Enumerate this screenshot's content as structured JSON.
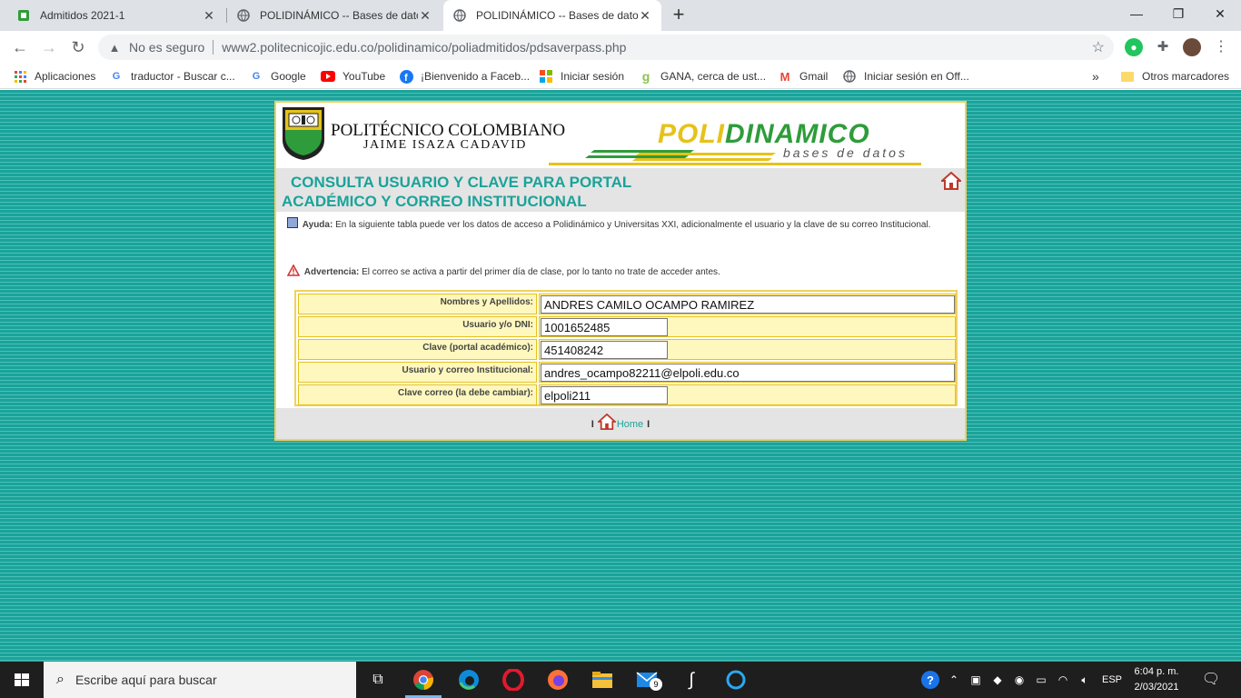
{
  "browser": {
    "tabs": [
      {
        "title": "Admitidos 2021-1",
        "active": false
      },
      {
        "title": "POLIDINÁMICO -- Bases de dato",
        "active": false
      },
      {
        "title": "POLIDINÁMICO -- Bases de dato",
        "active": true
      }
    ],
    "new_tab": "+",
    "window_controls": {
      "minimize": "—",
      "maximize": "❐",
      "close": "✕"
    },
    "security_label": "No es seguro",
    "url": "www2.politecnicojic.edu.co/polidinamico/poliadmitidos/pdsaverpass.php",
    "bookmarks": [
      {
        "label": "Aplicaciones",
        "icon": "apps-grid-icon"
      },
      {
        "label": "traductor - Buscar c...",
        "icon": "google-icon"
      },
      {
        "label": "Google",
        "icon": "google-icon"
      },
      {
        "label": "YouTube",
        "icon": "youtube-icon"
      },
      {
        "label": "¡Bienvenido a Faceb...",
        "icon": "facebook-icon"
      },
      {
        "label": "Iniciar sesión",
        "icon": "microsoft-icon"
      },
      {
        "label": "GANA, cerca de ust...",
        "icon": "gana-icon"
      },
      {
        "label": "Gmail",
        "icon": "gmail-icon"
      },
      {
        "label": "Iniciar sesión en Off...",
        "icon": "globe-icon"
      }
    ],
    "bookmarks_overflow": "»",
    "other_bookmarks": "Otros marcadores"
  },
  "page": {
    "institution_name": "POLITÉCNICO COLOMBIANO",
    "institution_sub": "JAIME ISAZA CADAVID",
    "brand_part1": "POLI",
    "brand_part2": "DINAMICO",
    "brand_sub": "bases de datos",
    "heading_line1": "CONSULTA USUARIO Y CLAVE PARA PORTAL",
    "heading_line2": "ACADÉMICO Y CORREO INSTITUCIONAL",
    "help_label": "Ayuda:",
    "help_text": "En la siguiente tabla puede ver los datos de acceso a Polidinámico y Universitas XXI, adicionalmente el usuario y la clave de su correo Institucional.",
    "warning_label": "Advertencia:",
    "warning_text": "El correo se activa a partir del primer día de clase, por lo tanto no trate de acceder antes.",
    "rows": [
      {
        "label": "Nombres y Apellidos:",
        "value": "ANDRES CAMILO OCAMPO RAMIREZ"
      },
      {
        "label": "Usuario y/o DNI:",
        "value": "1001652485"
      },
      {
        "label": "Clave (portal académico):",
        "value": "451408242"
      },
      {
        "label": "Usuario y correo Institucional:",
        "value": "andres_ocampo82211@elpoli.edu.co"
      },
      {
        "label": "Clave correo (la debe cambiar):",
        "value": "elpoli211"
      }
    ],
    "footer_sep": "I",
    "footer_home": "Home"
  },
  "taskbar": {
    "search_placeholder": "Escribe aquí para buscar",
    "mail_badge": "9",
    "language": "ESP",
    "time": "6:04 p. m.",
    "date": "2/03/2021"
  },
  "colors": {
    "teal": "#1aa39a",
    "gold": "#e6c21a",
    "green": "#2e9c3a",
    "cell_bg": "#fff8be"
  }
}
